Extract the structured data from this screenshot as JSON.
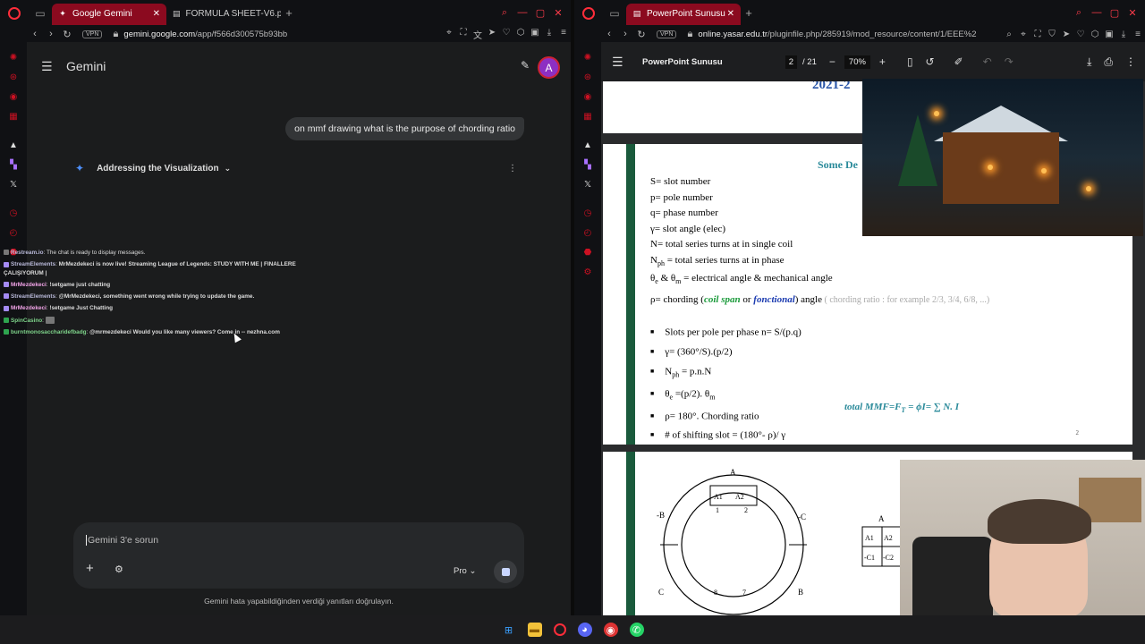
{
  "left_window": {
    "tabs": [
      {
        "title": "Google Gemini",
        "active": true,
        "icon": "gemini-star-icon"
      },
      {
        "title": "FORMULA SHEET-V6.pdf",
        "active": false,
        "icon": "pdf-icon"
      }
    ],
    "address": {
      "vpn_label": "VPN",
      "url_host": "gemini.google.com",
      "url_path": "/app/f566d300575b93bb"
    },
    "gemini": {
      "title": "Gemini",
      "avatar_letter": "A",
      "user_message": "on mmf drawing what is the purpose of chording ratio",
      "thinking_label": "Addressing the Visualization",
      "input_placeholder": "Gemini 3'e sorun",
      "model_label": "Pro",
      "disclaimer": "Gemini hata yapabildiğinden verdiği yanıtları doğrulayın."
    },
    "chat_overlay": [
      {
        "user": "Restream.io",
        "text": "The chat is ready to display messages."
      },
      {
        "user": "StreamElements",
        "text": "MrMezdekeci is now live! Streaming League of Legends: STUDY WITH ME | FINALLERE"
      },
      {
        "user": "",
        "text": "ÇALIŞIYORUM |"
      },
      {
        "user": "MrMezdekeci",
        "text": "!setgame just chatting"
      },
      {
        "user": "StreamElements",
        "text": "@MrMezdekeci, something went wrong while trying to update the game."
      },
      {
        "user": "MrMezdekeci",
        "text": "!setgame Just Chatting"
      },
      {
        "user": "SpinCasino",
        "text": ""
      },
      {
        "user": "burntmonosaccharidefbadg",
        "text": "@mrmezdekeci Would you like many viewers? Come in -- nezhna.com"
      }
    ]
  },
  "right_window": {
    "tabs": [
      {
        "title": "PowerPoint Sunusu",
        "active": true,
        "icon": "pdf-icon"
      }
    ],
    "address": {
      "vpn_label": "VPN",
      "url_host": "online.yasar.edu.tr",
      "url_path": "/pluginfile.php/285919/mod_resource/content/1/EEE%2"
    },
    "pdf": {
      "name": "PowerPoint Sunusu",
      "page_current": "2",
      "page_total": "/ 21",
      "zoom": "70%",
      "page1_year": "2021-2",
      "heading": "Some De",
      "definitions": {
        "d1": "S= slot number",
        "d2": "p= pole number",
        "d3": "q= phase number",
        "d4": "γ= slot angle (elec)",
        "d5": "N= total series turns at in  single coil",
        "d6a": "N",
        "d6sub": "ph",
        "d6b": " = total series turns at in phase",
        "d7a": "θ",
        "d7sub1": "e",
        "d7b": " & θ",
        "d7sub2": "m",
        "d7c": "  = electrical angle & mechanical angle",
        "d8a": "ρ= chording (",
        "d8b": "coil span",
        "d8c": " or ",
        "d8d": "fonctional",
        "d8e": ") angle",
        "d8f": " ( chording ratio : for example 2/3, 3/4, 6/8, ...)"
      },
      "bullets": {
        "b1": "Slots per pole per phase   n= S/(p.q)",
        "b2": "γ= (360°/S).(p/2)",
        "b3": "N",
        "b3sub": "ph",
        "b3b": " = p.n.N",
        "b4": "θ",
        "b4sub": "e",
        "b4b": " =(p/2). θ",
        "b4sub2": "m",
        "b5": "ρ= 180°. Chording ratio",
        "b6": "# of shifting slot = (180°- ρ)/ γ"
      },
      "formula": "total MMF=F",
      "formula_sub": "T",
      "formula_rest": " = ϕI= ∑ N. I",
      "page_number": "2",
      "diagram_labels": {
        "A": "A",
        "B": "B",
        "C": "C",
        "mB": "-B",
        "mC": "-C",
        "a1": "A1",
        "a2": "A2",
        "ca1": "-C1",
        "ca2": "-C2",
        "n1": "1",
        "n2": "2",
        "n7": "7",
        "n8": "8"
      }
    }
  },
  "taskbar": {
    "icons": [
      "windows-start-icon",
      "file-explorer-icon",
      "opera-icon",
      "discord-icon",
      "chrome-icon",
      "whatsapp-icon"
    ]
  }
}
